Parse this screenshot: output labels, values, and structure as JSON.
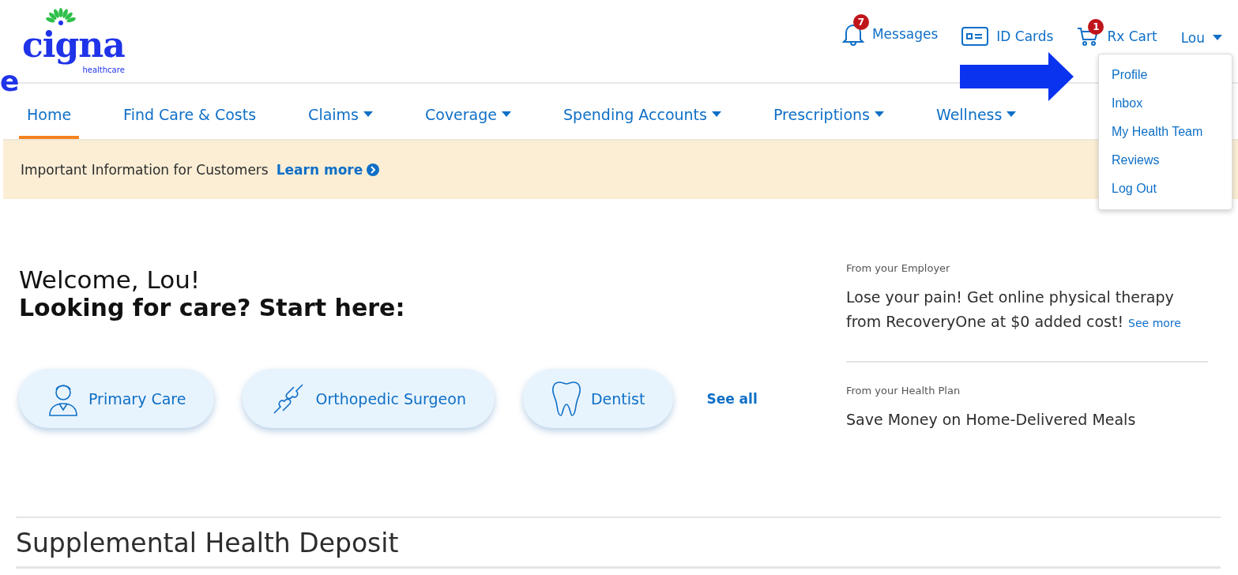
{
  "logo": {
    "wordmark": "cigna",
    "tagline": "healthcare"
  },
  "annotation": {
    "fragment": "e"
  },
  "top_links": [
    {
      "kind": "messages",
      "label": "Messages",
      "badge": "7"
    },
    {
      "kind": "idcard",
      "label": "ID Cards"
    },
    {
      "kind": "cart",
      "label": "Rx Cart",
      "badge": "1"
    },
    {
      "kind": "user",
      "label": "Lou",
      "expanded": true
    }
  ],
  "user_menu": [
    {
      "label": "Profile"
    },
    {
      "label": "Inbox"
    },
    {
      "label": "My Health Team"
    },
    {
      "label": "Reviews"
    },
    {
      "label": "Log Out"
    }
  ],
  "nav": [
    {
      "label": "Home",
      "selected": true,
      "has_menu": false
    },
    {
      "label": "Find Care & Costs",
      "selected": false,
      "has_menu": false
    },
    {
      "label": "Claims",
      "selected": false,
      "has_menu": true
    },
    {
      "label": "Coverage",
      "selected": false,
      "has_menu": true
    },
    {
      "label": "Spending Accounts",
      "selected": false,
      "has_menu": true
    },
    {
      "label": "Prescriptions",
      "selected": false,
      "has_menu": true
    },
    {
      "label": "Wellness",
      "selected": false,
      "has_menu": true
    }
  ],
  "banner": {
    "text": "Important Information for Customers",
    "link": "Learn more"
  },
  "welcome": {
    "greeting": "Welcome, Lou!",
    "prompt": "Looking for care? Start here:"
  },
  "care_buttons": [
    {
      "kind": "doctor",
      "label": "Primary Care"
    },
    {
      "kind": "joint",
      "label": "Orthopedic Surgeon"
    },
    {
      "kind": "tooth",
      "label": "Dentist"
    }
  ],
  "see_all": "See all",
  "promos": [
    {
      "source": "From your Employer",
      "headline": "Lose your pain! Get online physical therapy from RecoveryOne at $0 added cost!",
      "link": "See more"
    },
    {
      "source": "From your Health Plan",
      "headline": "Save Money on Home-Delivered Meals"
    }
  ],
  "section_title": "Supplemental Health Deposit"
}
